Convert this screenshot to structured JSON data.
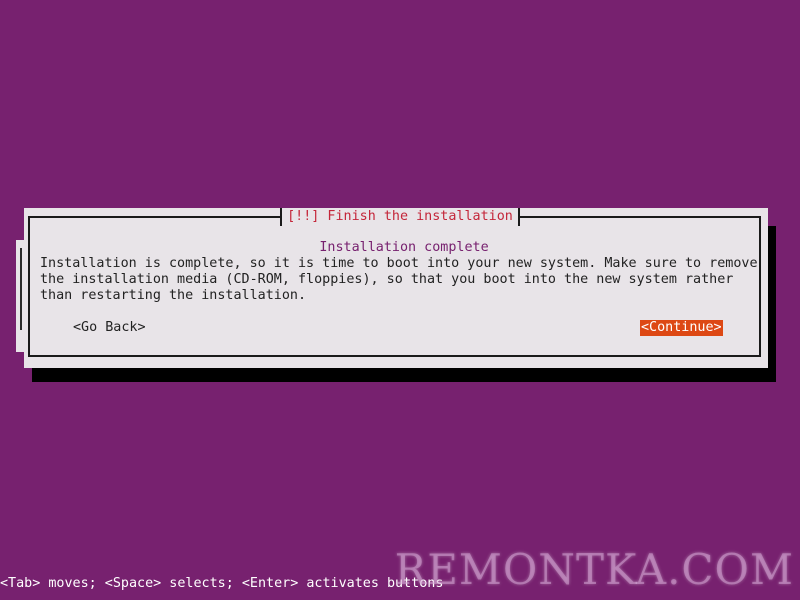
{
  "dialog": {
    "title": "[!!] Finish the installation",
    "heading": "Installation complete",
    "body_lines": [
      "Installation is complete, so it is time to boot into your new system. Make sure to remove",
      "the installation media (CD-ROM, floppies), so that you boot into the new system rather",
      "than restarting the installation."
    ],
    "go_back_label": "<Go Back>",
    "continue_label": "<Continue>"
  },
  "help_bar": {
    "text": "<Tab> moves; <Space> selects; <Enter> activates buttons"
  },
  "watermark": {
    "text": "REMONTKA.COM"
  },
  "colors": {
    "background": "#77216F",
    "dialog_bg": "#E8E4E8",
    "title_text": "#C4263A",
    "heading_text": "#77216F",
    "button_selected_bg": "#DD4814",
    "button_selected_text": "#FFFFFF"
  }
}
